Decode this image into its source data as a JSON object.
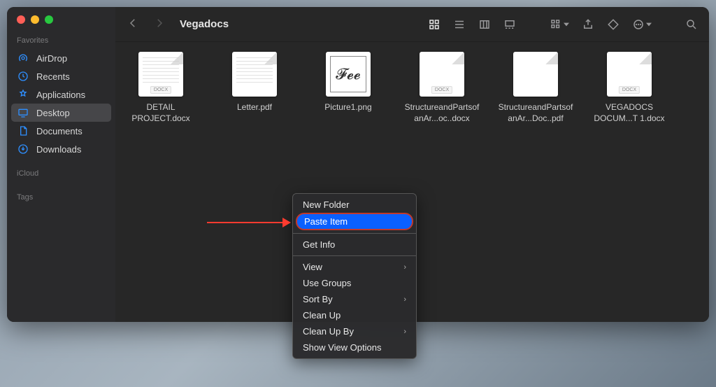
{
  "window": {
    "title": "Vegadocs"
  },
  "sidebar": {
    "sections": [
      {
        "heading": "Favorites",
        "items": [
          {
            "label": "AirDrop",
            "icon": "airdrop"
          },
          {
            "label": "Recents",
            "icon": "clock"
          },
          {
            "label": "Applications",
            "icon": "apps"
          },
          {
            "label": "Desktop",
            "icon": "desktop",
            "selected": true
          },
          {
            "label": "Documents",
            "icon": "doc"
          },
          {
            "label": "Downloads",
            "icon": "download"
          }
        ]
      },
      {
        "heading": "iCloud",
        "items": []
      },
      {
        "heading": "Tags",
        "items": []
      }
    ]
  },
  "toolbar": {
    "view_active": "icons",
    "icons_right": [
      "group-by",
      "share",
      "tag",
      "more",
      "search"
    ]
  },
  "files": [
    {
      "name": "DETAIL PROJECT.docx",
      "ext": "DOCX",
      "thumb": "doc-lines"
    },
    {
      "name": "Letter.pdf",
      "ext": "PDF",
      "thumb": "doc-lines"
    },
    {
      "name": "Picture1.png",
      "ext": "PNG",
      "thumb": "signature"
    },
    {
      "name": "StructureandPartsofanAr...oc..docx",
      "ext": "DOCX",
      "thumb": "doc-blank"
    },
    {
      "name": "StructureandPartsofanAr...Doc..pdf",
      "ext": "PDF",
      "thumb": "doc-blank"
    },
    {
      "name": "VEGADOCS DOCUM...T 1.docx",
      "ext": "DOCX",
      "thumb": "doc-blank"
    }
  ],
  "context_menu": {
    "groups": [
      [
        {
          "label": "New Folder"
        },
        {
          "label": "Paste Item",
          "highlighted": true
        }
      ],
      [
        {
          "label": "Get Info"
        }
      ],
      [
        {
          "label": "View",
          "submenu": true
        },
        {
          "label": "Use Groups"
        },
        {
          "label": "Sort By",
          "submenu": true
        },
        {
          "label": "Clean Up"
        },
        {
          "label": "Clean Up By",
          "submenu": true
        },
        {
          "label": "Show View Options"
        }
      ]
    ]
  }
}
